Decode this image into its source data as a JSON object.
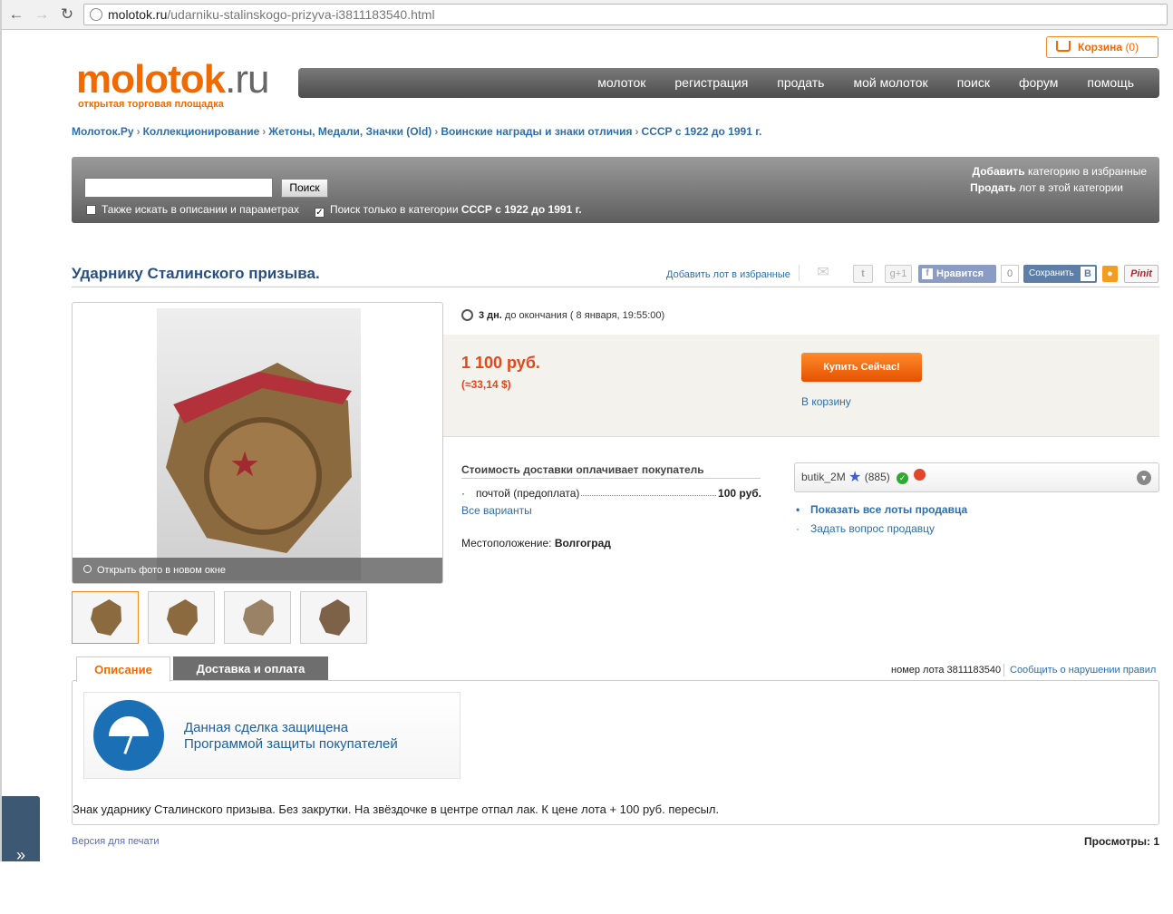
{
  "browser": {
    "url_domain": "molotok.ru",
    "url_path": "/udarniku-stalinskogo-prizyva-i3811183540.html"
  },
  "cart": {
    "label": "Корзина",
    "count": "(0)"
  },
  "logo": {
    "brand": "molotok",
    "domain": ".ru",
    "tagline": "открытая торговая площадка"
  },
  "nav": [
    "молоток",
    "регистрация",
    "продать",
    "мой молоток",
    "поиск",
    "форум",
    "помощь"
  ],
  "breadcrumbs": [
    "Молоток.Ру",
    "Коллекционирование",
    "Жетоны, Медали, Значки (Old)",
    "Воинские награды и знаки отличия",
    "СССР с 1922 до 1991 г."
  ],
  "search": {
    "value": "",
    "button": "Поиск",
    "check_desc": "Также искать в описании и параметрах",
    "check_category_prefix": "Поиск только в категории",
    "check_category_name": "СССР с 1922 до 1991 г.",
    "fav_bold": "Добавить",
    "fav_rest": "категорию в избранные",
    "sell_bold": "Продать",
    "sell_rest": "лот в этой категории"
  },
  "lot": {
    "title": "Ударнику Сталинского призыва.",
    "add_favorite": "Добавить лот в избранные",
    "timer_days": "3 дн.",
    "timer_rest": "до окончания ( 8 января, 19:55:00)",
    "price": "1 100 руб.",
    "price_usd": "(≈33,14 $)",
    "buy_now": "Купить Сейчас!",
    "to_cart": "В корзину",
    "photo_caption": "Открыть фото в новом окне",
    "shipping_head": "Стоимость доставки оплачивает покупатель",
    "shipping_method": "почтой (предоплата)",
    "shipping_price": "100 руб.",
    "all_variants": "Все варианты",
    "location_label": "Местоположение:",
    "location_value": "Волгоград"
  },
  "share": {
    "gplus": "g+1",
    "like": "Нравится",
    "like_count": "0",
    "vk_save": "Сохранить",
    "vk_b": "B",
    "pinit": "Pinit"
  },
  "seller": {
    "name": "butik_2M",
    "rating": "(885)",
    "show_all": "Показать все лоты продавца",
    "ask": "Задать вопрос продавцу"
  },
  "tabs": {
    "description": "Описание",
    "shipping": "Доставка и оплата"
  },
  "lot_number": "номер лота 3811183540",
  "report": "Сообщить о нарушении правил",
  "protection": {
    "line1": "Данная сделка защищена",
    "line2": "Программой защиты покупателей"
  },
  "description": "Знак ударнику Сталинского призыва. Без закрутки. На звёздочке в центре отпал лак. К цене лота + 100 руб. пересыл.",
  "print_version": "Версия для печати",
  "views": "Просмотры: 1",
  "collapse": "»"
}
